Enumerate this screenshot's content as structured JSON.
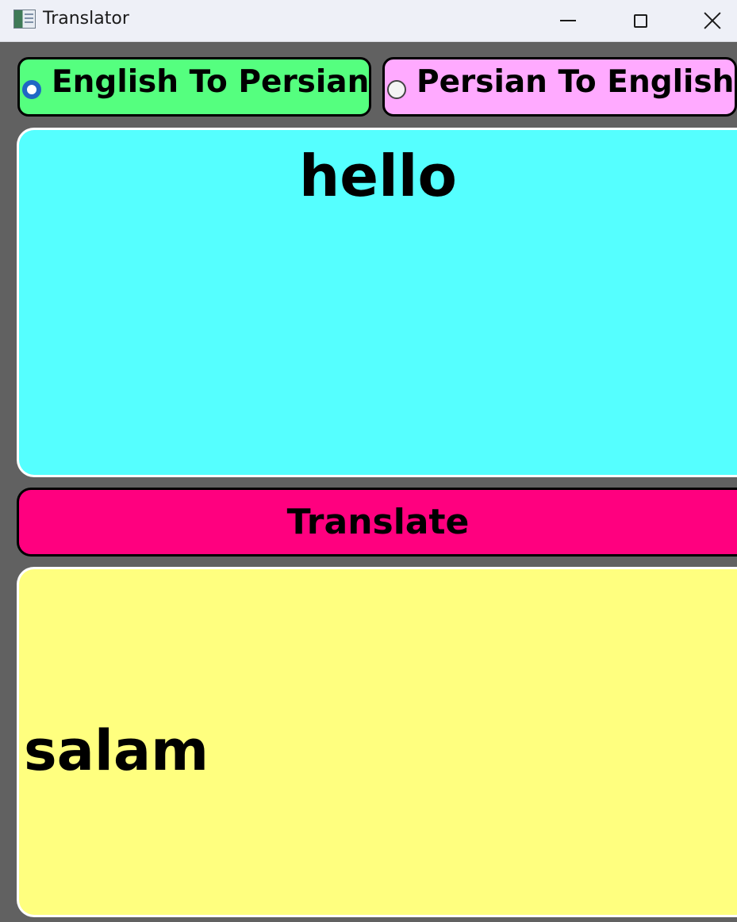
{
  "window": {
    "title": "Translator",
    "icon": "app-window-icon"
  },
  "mode": {
    "selected": "english_to_persian",
    "options": [
      {
        "label": "English To Persian",
        "checked": true,
        "color": "#55ff7f"
      },
      {
        "label": "Persian To English",
        "checked": false,
        "color": "#ffaaff"
      }
    ]
  },
  "input": {
    "value": "hello",
    "color": "#55ffff"
  },
  "translate_button": {
    "label": "Translate",
    "color": "#ff007f"
  },
  "output": {
    "value": "salam",
    "color": "#ffff7f"
  }
}
